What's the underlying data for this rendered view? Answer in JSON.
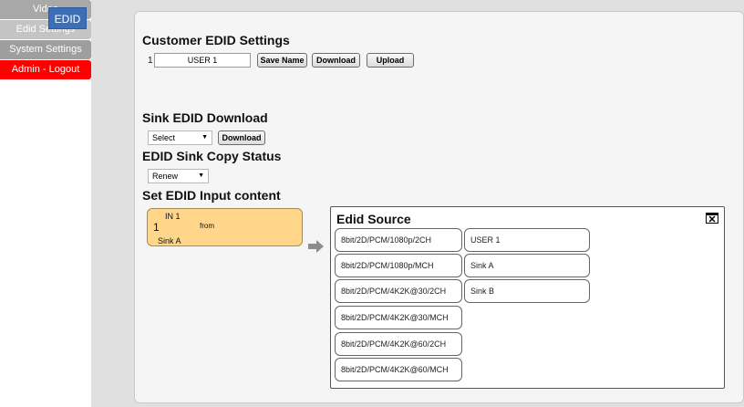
{
  "sidebar": {
    "items": [
      {
        "label": "Video"
      },
      {
        "label": "Edid Settings"
      },
      {
        "label": "System Settings"
      },
      {
        "label": "Admin - Logout"
      }
    ]
  },
  "tab": {
    "label": "EDID"
  },
  "customer": {
    "heading": "Customer EDID Settings",
    "index": "1",
    "name_value": "USER 1",
    "save_label": "Save Name",
    "download_label": "Download",
    "upload_label": "Upload"
  },
  "sink_download": {
    "heading": "Sink EDID Download",
    "select_value": "Select",
    "download_label": "Download"
  },
  "sink_copy": {
    "heading": "EDID Sink Copy Status",
    "select_value": "Renew"
  },
  "input_content": {
    "heading": "Set EDID Input content",
    "in_label": "IN 1",
    "in_number": "1",
    "from_label": "from",
    "source_value": "Sink A"
  },
  "edid_source": {
    "heading": "Edid Source",
    "formats": [
      "8bit/2D/PCM/1080p/2CH",
      "8bit/2D/PCM/1080p/MCH",
      "8bit/2D/PCM/4K2K@30/2CH",
      "8bit/2D/PCM/4K2K@30/MCH",
      "8bit/2D/PCM/4K2K@60/2CH",
      "8bit/2D/PCM/4K2K@60/MCH"
    ],
    "sources": [
      "USER 1",
      "Sink A",
      "Sink B"
    ]
  },
  "colors": {
    "tab": "#3d6fb8",
    "logout": "#ff0000",
    "input_box": "#ffd68a"
  }
}
